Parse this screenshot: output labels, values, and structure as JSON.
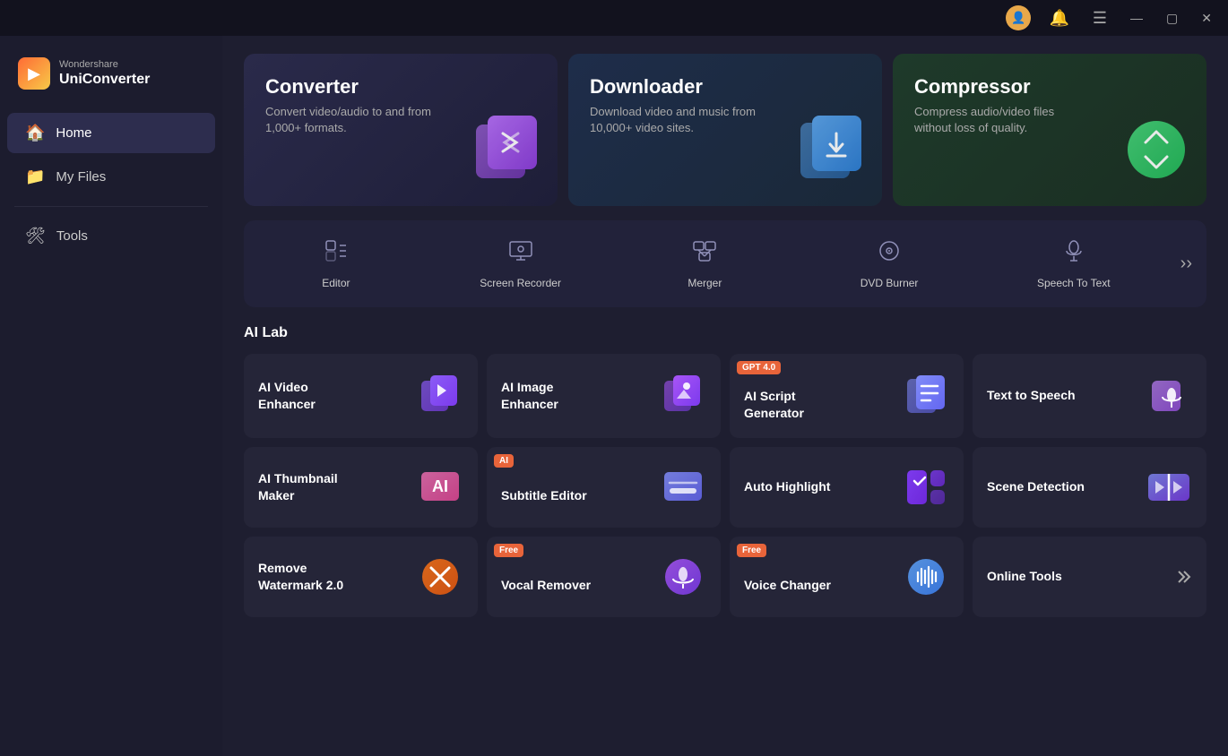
{
  "titlebar": {
    "user_icon": "👤",
    "bell_icon": "🔔",
    "menu_icon": "☰",
    "minimize": "—",
    "maximize": "▢",
    "close": "✕"
  },
  "logo": {
    "brand": "Wondershare",
    "product": "UniConverter"
  },
  "nav": {
    "items": [
      {
        "id": "home",
        "label": "Home",
        "icon": "🏠",
        "active": true
      },
      {
        "id": "myfiles",
        "label": "My Files",
        "icon": "📁",
        "active": false
      }
    ],
    "tools_label": "Tools",
    "tools_icon": "🛠"
  },
  "hero": {
    "cards": [
      {
        "id": "converter",
        "title": "Converter",
        "desc": "Convert video/audio to and from 1,000+ formats.",
        "color": "converter"
      },
      {
        "id": "downloader",
        "title": "Downloader",
        "desc": "Download video and music from 10,000+ video sites.",
        "color": "downloader"
      },
      {
        "id": "compressor",
        "title": "Compressor",
        "desc": "Compress audio/video files without loss of quality.",
        "color": "compressor"
      }
    ]
  },
  "tools": {
    "items": [
      {
        "id": "editor",
        "label": "Editor"
      },
      {
        "id": "screen-recorder",
        "label": "Screen Recorder"
      },
      {
        "id": "merger",
        "label": "Merger"
      },
      {
        "id": "dvd-burner",
        "label": "DVD Burner"
      },
      {
        "id": "speech-to-text",
        "label": "Speech To Text"
      }
    ],
    "more": ">>"
  },
  "ai_lab": {
    "title": "AI Lab",
    "cards": [
      {
        "id": "ai-video-enhancer",
        "title": "AI Video\nEnhancer",
        "badge": null
      },
      {
        "id": "ai-image-enhancer",
        "title": "AI Image\nEnhancer",
        "badge": null
      },
      {
        "id": "ai-script-generator",
        "title": "AI Script\nGenerator",
        "badge": "GPT 4.0"
      },
      {
        "id": "text-to-speech",
        "title": "Text to Speech",
        "badge": null
      },
      {
        "id": "ai-thumbnail-maker",
        "title": "AI Thumbnail\nMaker",
        "badge": null
      },
      {
        "id": "subtitle-editor",
        "title": "Subtitle Editor",
        "badge": "AI"
      },
      {
        "id": "auto-highlight",
        "title": "Auto Highlight",
        "badge": null
      },
      {
        "id": "scene-detection",
        "title": "Scene Detection",
        "badge": null
      },
      {
        "id": "remove-watermark",
        "title": "Remove\nWatermark 2.0",
        "badge": null
      },
      {
        "id": "vocal-remover",
        "title": "Vocal Remover",
        "badge": "Free"
      },
      {
        "id": "voice-changer",
        "title": "Voice Changer",
        "badge": "Free"
      },
      {
        "id": "online-tools",
        "title": "Online Tools",
        "badge": null,
        "has_arrow": true
      }
    ]
  }
}
